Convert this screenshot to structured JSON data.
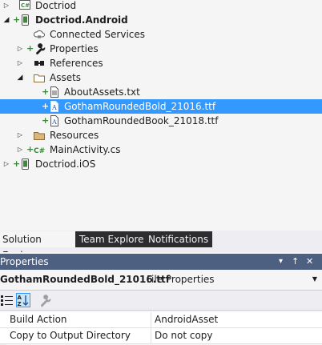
{
  "tree": [
    {
      "label": "Doctriod",
      "arrow": "collapsed",
      "plus": false,
      "icon": "csharp-project-icon",
      "bold": false
    },
    {
      "label": "Doctriod.Android",
      "arrow": "expanded",
      "plus": true,
      "icon": "android-project-icon",
      "bold": true
    },
    {
      "label": "Connected Services",
      "arrow": "none",
      "plus": false,
      "icon": "connected-services-icon",
      "bold": false
    },
    {
      "label": "Properties",
      "arrow": "collapsed",
      "plus": true,
      "icon": "wrench-icon",
      "bold": false
    },
    {
      "label": "References",
      "arrow": "collapsed",
      "plus": false,
      "icon": "references-icon",
      "bold": false
    },
    {
      "label": "Assets",
      "arrow": "expanded",
      "plus": false,
      "icon": "folder-icon",
      "bold": false
    },
    {
      "label": "AboutAssets.txt",
      "arrow": "none",
      "plus": true,
      "icon": "text-file-icon",
      "bold": false
    },
    {
      "label": "GothamRoundedBold_21016.ttf",
      "arrow": "none",
      "plus": true,
      "icon": "font-file-icon",
      "bold": false,
      "selected": true
    },
    {
      "label": "GothamRoundedBook_21018.ttf",
      "arrow": "none",
      "plus": true,
      "icon": "font-file-icon",
      "bold": false
    },
    {
      "label": "Resources",
      "arrow": "collapsed",
      "plus": false,
      "icon": "folder-icon",
      "bold": false
    },
    {
      "label": "MainActivity.cs",
      "arrow": "collapsed",
      "plus": true,
      "icon": "csharp-file-icon",
      "bold": false
    },
    {
      "label": "Doctriod.iOS",
      "arrow": "collapsed",
      "plus": true,
      "icon": "ios-project-icon",
      "bold": false
    }
  ],
  "tabs": [
    "Solution Explorer",
    "Team Explorer",
    "Notifications"
  ],
  "properties": {
    "title": "Properties",
    "pin_glyph": "▾ ↑ ✕",
    "object_name": "GothamRoundedBold_21016.ttf",
    "object_type": "File Properties",
    "rows": [
      {
        "key": "Build Action",
        "value": "AndroidAsset"
      },
      {
        "key": "Copy to Output Directory",
        "value": "Do not copy"
      }
    ]
  },
  "colors": {
    "selection": "#3399ff",
    "tab_dark": "#2d2d30",
    "title_bar": "#4d6082"
  }
}
